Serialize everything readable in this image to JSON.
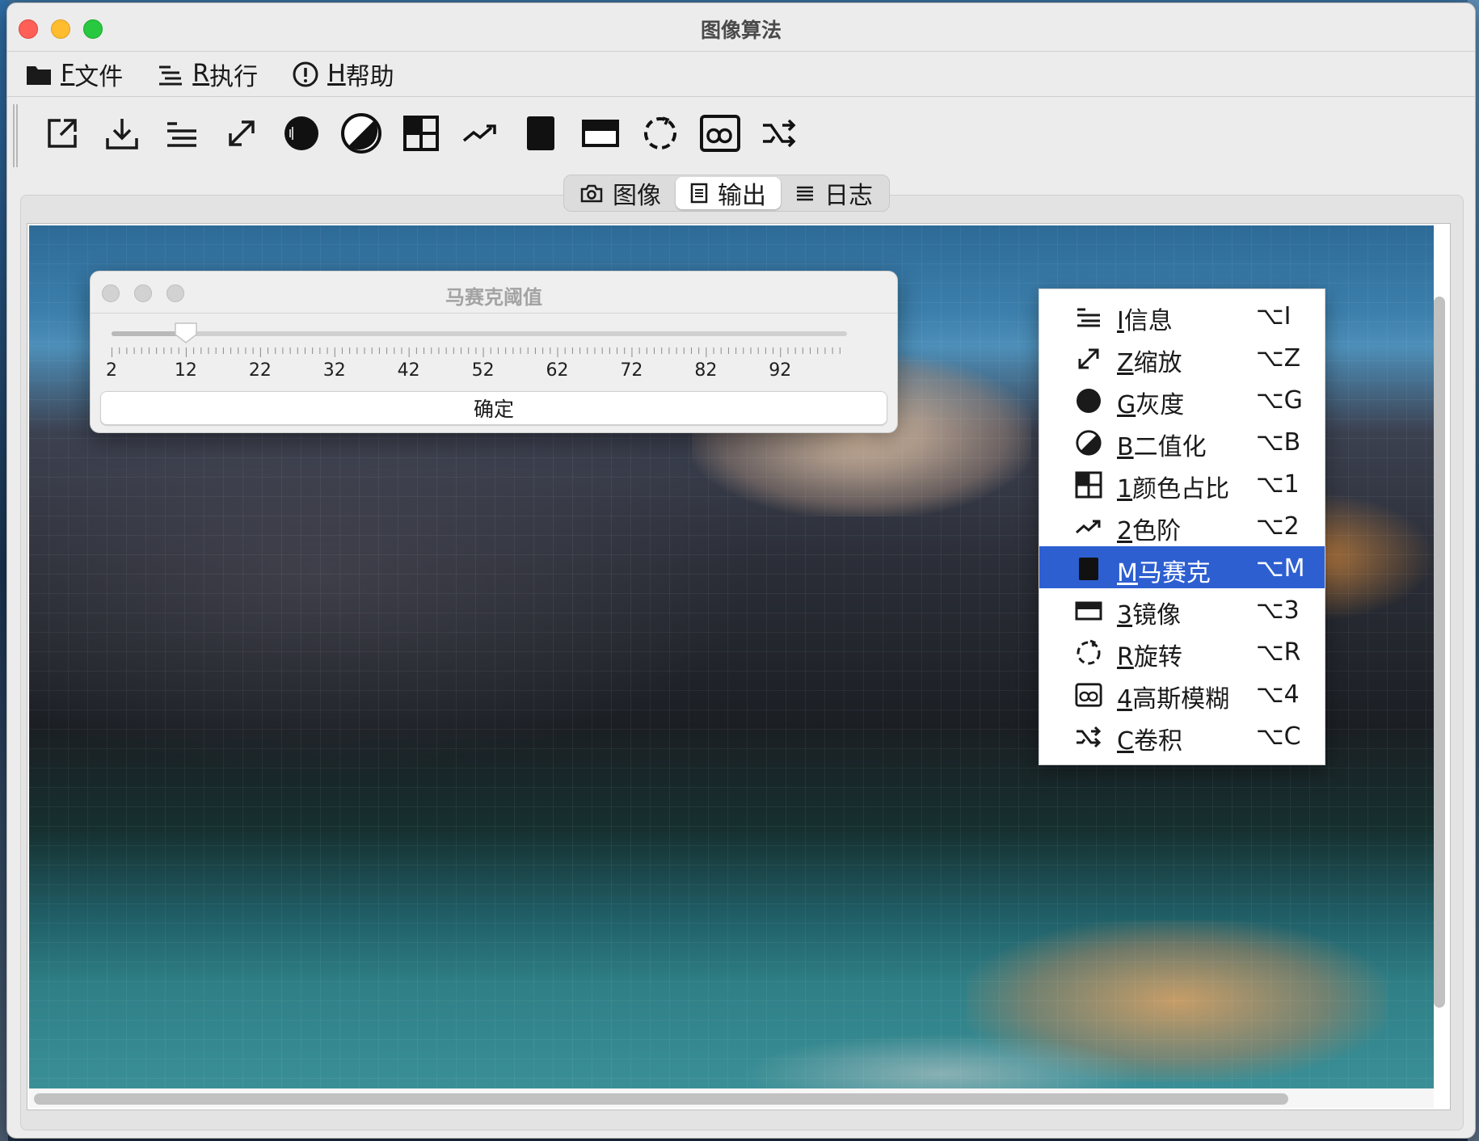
{
  "window": {
    "title": "图像算法"
  },
  "menubar": [
    {
      "mnemonic": "F",
      "label": "文件",
      "icon": "folder-icon"
    },
    {
      "mnemonic": "R",
      "label": "执行",
      "icon": "run-list-icon"
    },
    {
      "mnemonic": "H",
      "label": "帮助",
      "icon": "help-circle-icon"
    }
  ],
  "toolbar": [
    "open-external-icon",
    "download-icon",
    "info-list-icon",
    "resize-icon",
    "grayscale-icon",
    "binarize-icon",
    "color-ratio-icon",
    "levels-icon",
    "mosaic-icon",
    "mirror-icon",
    "rotate-icon",
    "gaussian-blur-icon",
    "convolution-icon"
  ],
  "tabs": [
    {
      "label": "图像",
      "icon": "camera-icon",
      "active": false
    },
    {
      "label": "输出",
      "icon": "document-icon",
      "active": true
    },
    {
      "label": "日志",
      "icon": "lines-icon",
      "active": false
    }
  ],
  "dialog": {
    "title": "马赛克阈值",
    "slider": {
      "min": 2,
      "max": 101,
      "value": 12
    },
    "tick_labels": [
      "2",
      "12",
      "22",
      "32",
      "42",
      "52",
      "62",
      "72",
      "82",
      "92"
    ],
    "ok_label": "确定"
  },
  "dropdown": [
    {
      "mnemonic": "I",
      "label": "信息",
      "shortcut": "⌥I",
      "icon": "info-list-icon",
      "selected": false
    },
    {
      "mnemonic": "Z",
      "label": "缩放",
      "shortcut": "⌥Z",
      "icon": "resize-icon",
      "selected": false
    },
    {
      "mnemonic": "G",
      "label": "灰度",
      "shortcut": "⌥G",
      "icon": "grayscale-icon",
      "selected": false
    },
    {
      "mnemonic": "B",
      "label": "二值化",
      "shortcut": "⌥B",
      "icon": "binarize-icon",
      "selected": false
    },
    {
      "mnemonic": "1",
      "label": "颜色占比",
      "shortcut": "⌥1",
      "icon": "color-ratio-icon",
      "selected": false
    },
    {
      "mnemonic": "2",
      "label": "色阶",
      "shortcut": "⌥2",
      "icon": "levels-icon",
      "selected": false
    },
    {
      "mnemonic": "M",
      "label": "马赛克",
      "shortcut": "⌥M",
      "icon": "mosaic-icon",
      "selected": true
    },
    {
      "mnemonic": "3",
      "label": "镜像",
      "shortcut": "⌥3",
      "icon": "mirror-icon",
      "selected": false
    },
    {
      "mnemonic": "R",
      "label": "旋转",
      "shortcut": "⌥R",
      "icon": "rotate-icon",
      "selected": false
    },
    {
      "mnemonic": "4",
      "label": "高斯模糊",
      "shortcut": "⌥4",
      "icon": "gaussian-blur-icon",
      "selected": false
    },
    {
      "mnemonic": "C",
      "label": "卷积",
      "shortcut": "⌥C",
      "icon": "convolution-icon",
      "selected": false
    }
  ],
  "colors": {
    "selection": "#2d5fd1",
    "close": "#fe5f57",
    "minimize": "#febc2e",
    "maximize": "#28c840"
  }
}
